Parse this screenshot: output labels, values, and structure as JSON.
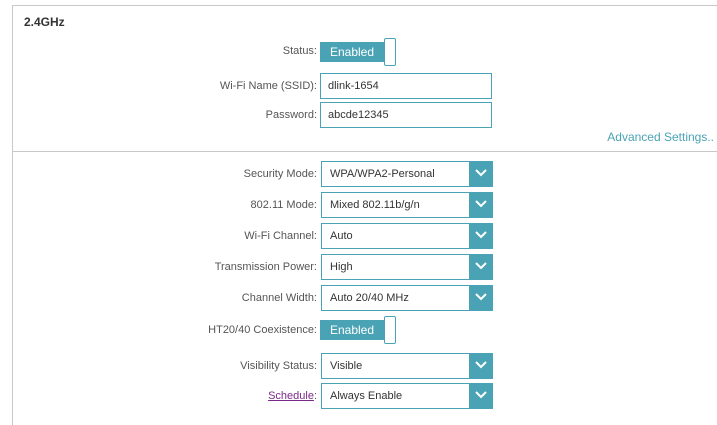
{
  "band": {
    "title": "2.4GHz"
  },
  "basic": {
    "status_label": "Status:",
    "status_value": "Enabled",
    "ssid_label": "Wi-Fi Name (SSID):",
    "ssid_value": "dlink-1654",
    "password_label": "Password:",
    "password_value": "abcde12345",
    "advanced_link": "Advanced Settings.."
  },
  "advanced": {
    "security_mode": {
      "label": "Security Mode:",
      "value": "WPA/WPA2-Personal"
    },
    "mode_80211": {
      "label": "802.11 Mode:",
      "value": "Mixed 802.11b/g/n"
    },
    "channel": {
      "label": "Wi-Fi Channel:",
      "value": "Auto"
    },
    "tx_power": {
      "label": "Transmission Power:",
      "value": "High"
    },
    "channel_width": {
      "label": "Channel Width:",
      "value": "Auto 20/40 MHz"
    },
    "ht_coexistence": {
      "label": "HT20/40 Coexistence:",
      "value": "Enabled"
    },
    "visibility": {
      "label": "Visibility Status:",
      "value": "Visible"
    },
    "schedule": {
      "link_label": "Schedule",
      "colon": ":",
      "value": "Always Enable"
    }
  },
  "colors": {
    "accent": "#4aa3b5",
    "link_visited": "#7b2a8a"
  },
  "icons": {
    "dropdown": "chevron-down-icon"
  }
}
